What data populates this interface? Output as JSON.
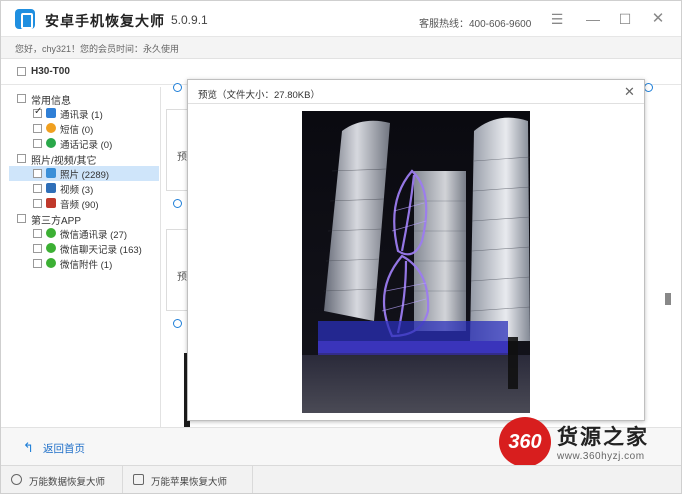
{
  "app": {
    "title": "安卓手机恢复大师",
    "version": "5.0.9.1",
    "hotline": "客服热线：400-606-9600",
    "greeting": "您好，chy321！您的会员时间：永久使用"
  },
  "device": {
    "name": "H30-T00"
  },
  "sidebar": {
    "categories": [
      {
        "label": "常用信息",
        "items": [
          {
            "label": "通讯录 (1)",
            "checked": true,
            "icon": "contacts-icon",
            "color": "#2f7fd6"
          },
          {
            "label": "短信 (0)",
            "checked": false,
            "icon": "sms-icon",
            "color": "#f0a020"
          },
          {
            "label": "通话记录 (0)",
            "checked": false,
            "icon": "call-log-icon",
            "color": "#2aa84a"
          }
        ]
      },
      {
        "label": "照片/视频/其它",
        "items": [
          {
            "label": "照片 (2289)",
            "checked": false,
            "icon": "photo-icon",
            "color": "#3a8fd8",
            "selected": true
          },
          {
            "label": "视频 (3)",
            "checked": false,
            "icon": "video-icon",
            "color": "#2f6fb8"
          },
          {
            "label": "音频 (90)",
            "checked": false,
            "icon": "audio-icon",
            "color": "#c0392b"
          }
        ]
      },
      {
        "label": "第三方APP",
        "items": [
          {
            "label": "微信通讯录 (27)",
            "checked": false,
            "icon": "wechat-icon",
            "color": "#3cb034"
          },
          {
            "label": "微信聊天记录 (163)",
            "checked": false,
            "icon": "wechat-icon",
            "color": "#3cb034"
          },
          {
            "label": "微信附件 (1)",
            "checked": false,
            "icon": "wechat-icon",
            "color": "#3cb034"
          }
        ]
      }
    ]
  },
  "main": {
    "peek_label": "预"
  },
  "dialog": {
    "title": "预览（文件大小：27.80KB）"
  },
  "bottom": {
    "back_label": "返回首页"
  },
  "watermark": {
    "badge": "360",
    "title": "货源之家",
    "url": "www.360hyzj.com"
  },
  "footer": {
    "tabs": [
      {
        "label": "万能数据恢复大师",
        "icon": "data-recovery-icon"
      },
      {
        "label": "万能苹果恢复大师",
        "icon": "apple-recovery-icon"
      }
    ]
  }
}
